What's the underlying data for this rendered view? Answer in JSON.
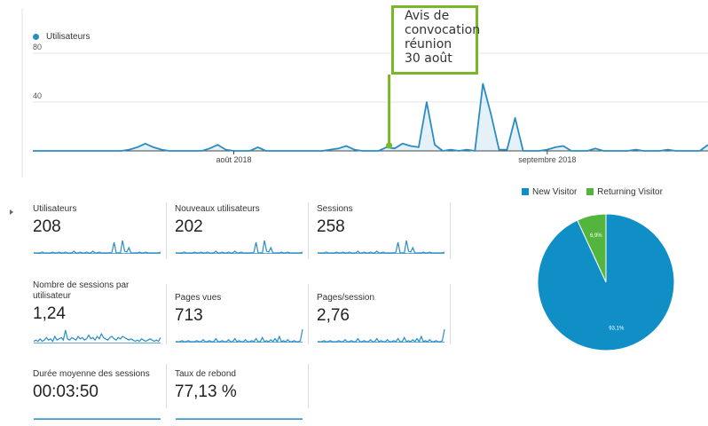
{
  "chart_data": [
    {
      "type": "area",
      "series": [
        {
          "name": "Utilisateurs",
          "color": "#2b8cc4",
          "values": [
            0,
            0,
            0,
            0,
            0,
            0,
            0,
            0,
            0,
            0,
            0,
            0,
            1,
            3,
            6,
            3,
            1,
            0,
            0,
            0,
            0,
            0,
            2,
            5,
            1,
            0,
            0,
            0,
            3,
            0,
            0,
            0,
            0,
            0,
            0,
            0,
            0,
            1,
            2,
            4,
            1,
            0,
            0,
            0,
            3,
            2,
            6,
            4,
            3,
            40,
            5,
            0,
            1,
            0,
            1,
            0,
            55,
            30,
            1,
            1,
            27,
            0,
            0,
            0,
            1,
            3,
            4,
            0,
            0,
            0,
            2,
            0,
            0,
            0,
            0,
            1,
            0,
            0,
            0,
            1,
            0,
            0,
            0,
            0,
            5
          ]
        }
      ],
      "ylim": [
        0,
        80
      ],
      "yticks": [
        "80",
        "40"
      ],
      "xtick_labels": [
        {
          "label": "août 2018",
          "index": 25
        },
        {
          "label": "septembre 2018",
          "index": 64
        }
      ],
      "annotation": {
        "lines": [
          "Avis de",
          "convocation",
          "réunion",
          "30 août"
        ],
        "index": 44,
        "color": "#7ab629"
      }
    },
    {
      "type": "pie",
      "slices": [
        {
          "name": "New Visitor",
          "value": 93.1,
          "label": "93,1%",
          "color": "#0f8fc6"
        },
        {
          "name": "Returning Visitor",
          "value": 6.9,
          "label": "6,9%",
          "color": "#54b53e"
        }
      ]
    }
  ],
  "metrics": [
    {
      "label": "Utilisateurs",
      "value": "208",
      "spark": [
        0,
        0,
        0,
        0,
        1,
        0,
        0,
        0,
        0,
        1,
        0,
        0,
        1,
        0,
        0,
        1,
        0,
        0,
        0,
        2,
        0,
        0,
        1,
        0,
        0,
        1,
        0,
        0,
        2,
        0,
        0,
        1,
        0,
        0,
        0,
        0,
        0,
        1,
        12,
        0,
        0,
        0,
        14,
        2,
        1,
        6,
        0,
        0,
        0,
        0,
        1,
        0,
        0,
        1,
        0,
        0,
        0,
        0,
        0,
        0,
        1
      ]
    },
    {
      "label": "Nouveaux utilisateurs",
      "value": "202",
      "spark": [
        0,
        0,
        0,
        0,
        1,
        0,
        0,
        0,
        0,
        1,
        0,
        0,
        1,
        0,
        0,
        1,
        0,
        0,
        0,
        2,
        0,
        0,
        1,
        0,
        0,
        1,
        0,
        0,
        2,
        0,
        0,
        1,
        0,
        0,
        0,
        0,
        0,
        1,
        12,
        0,
        0,
        0,
        14,
        2,
        1,
        6,
        0,
        0,
        0,
        0,
        1,
        0,
        0,
        1,
        0,
        0,
        0,
        0,
        0,
        0,
        1
      ]
    },
    {
      "label": "Sessions",
      "value": "258",
      "spark": [
        0,
        0,
        0,
        0,
        1,
        0,
        0,
        0,
        0,
        1,
        0,
        0,
        1,
        0,
        0,
        1,
        0,
        0,
        0,
        2,
        0,
        0,
        1,
        0,
        0,
        1,
        0,
        0,
        2,
        0,
        0,
        1,
        0,
        0,
        0,
        0,
        0,
        1,
        12,
        0,
        0,
        0,
        14,
        2,
        1,
        6,
        0,
        0,
        0,
        0,
        1,
        0,
        0,
        1,
        0,
        0,
        0,
        0,
        0,
        0,
        1
      ]
    },
    {
      "label": "Nombre de sessions par utilisateur",
      "value": "1,24",
      "spark": [
        1,
        2,
        1,
        3,
        1,
        2,
        4,
        2,
        3,
        1,
        5,
        2,
        3,
        4,
        2,
        10,
        3,
        2,
        4,
        3,
        2,
        5,
        3,
        4,
        2,
        3,
        6,
        3,
        4,
        2,
        5,
        3,
        7,
        4,
        3,
        2,
        4,
        5,
        3,
        2,
        4,
        3,
        5,
        4,
        3,
        2,
        3,
        2,
        1,
        2,
        1,
        3,
        2,
        1,
        2,
        3,
        2,
        1,
        2,
        1,
        4
      ]
    },
    {
      "label": "Pages vues",
      "value": "713",
      "spark": [
        0,
        0,
        0,
        1,
        0,
        0,
        1,
        0,
        0,
        0,
        1,
        0,
        0,
        2,
        0,
        0,
        1,
        0,
        0,
        3,
        0,
        0,
        1,
        0,
        0,
        2,
        0,
        0,
        3,
        0,
        1,
        0,
        0,
        2,
        0,
        0,
        1,
        0,
        3,
        0,
        0,
        4,
        0,
        1,
        0,
        2,
        0,
        3,
        0,
        5,
        0,
        1,
        0,
        2,
        0,
        0,
        1,
        0,
        0,
        1,
        12
      ]
    },
    {
      "label": "Pages/session",
      "value": "2,76",
      "spark": [
        0,
        0,
        0,
        1,
        0,
        0,
        1,
        0,
        0,
        0,
        1,
        0,
        0,
        2,
        0,
        0,
        1,
        0,
        0,
        3,
        0,
        0,
        1,
        0,
        0,
        2,
        0,
        0,
        3,
        0,
        1,
        0,
        0,
        2,
        0,
        0,
        1,
        0,
        3,
        0,
        0,
        4,
        0,
        1,
        0,
        2,
        0,
        3,
        0,
        5,
        0,
        1,
        0,
        2,
        0,
        0,
        1,
        0,
        0,
        1,
        12
      ]
    },
    {
      "label": "Durée moyenne des sessions",
      "value": "00:03:50",
      "spark": [
        0,
        0,
        0,
        0,
        0,
        0,
        0,
        0,
        0,
        0,
        0,
        0,
        0,
        0,
        0,
        0,
        0,
        0,
        0,
        0,
        0,
        0,
        0,
        0,
        0,
        0,
        0,
        0,
        0,
        0,
        0,
        0,
        0,
        0,
        0,
        0,
        0,
        0,
        0,
        0,
        0,
        0,
        0,
        0,
        0,
        0,
        0,
        0,
        0,
        0,
        0,
        0,
        0,
        0,
        0,
        0,
        0,
        0,
        0,
        0,
        0
      ]
    },
    {
      "label": "Taux de rebond",
      "value": "77,13 %",
      "spark": [
        0,
        0,
        0,
        0,
        0,
        0,
        0,
        0,
        0,
        0,
        0,
        0,
        0,
        0,
        0,
        0,
        0,
        0,
        0,
        0,
        0,
        0,
        0,
        0,
        0,
        0,
        0,
        0,
        0,
        0,
        0,
        0,
        0,
        0,
        0,
        0,
        0,
        0,
        0,
        0,
        0,
        0,
        0,
        0,
        0,
        0,
        0,
        0,
        0,
        0,
        0,
        0,
        0,
        0,
        0,
        0,
        0,
        0,
        0,
        0,
        0
      ]
    }
  ]
}
